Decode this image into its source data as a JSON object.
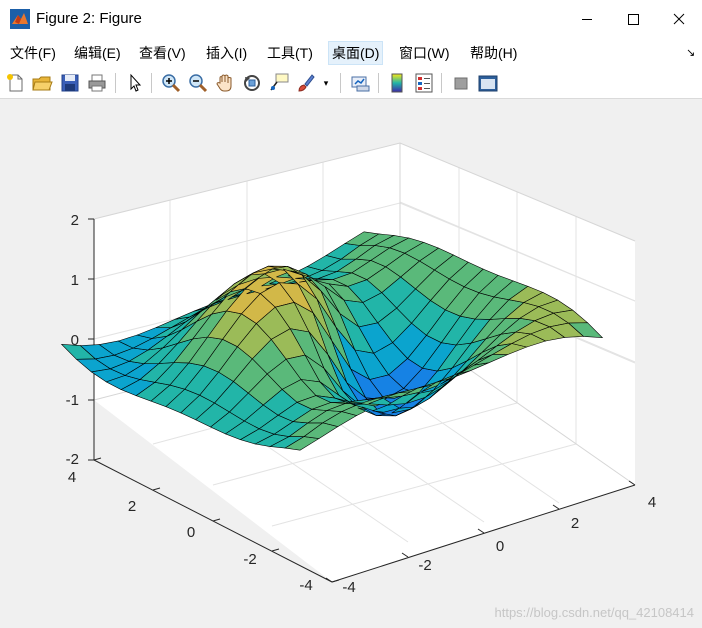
{
  "window": {
    "title": "Figure 2: Figure",
    "minimize_icon": "minimize-icon",
    "maximize_icon": "maximize-icon",
    "close_icon": "close-icon"
  },
  "menu": {
    "items": [
      {
        "label": "文件(F)"
      },
      {
        "label": "编辑(E)"
      },
      {
        "label": "查看(V)"
      },
      {
        "label": "插入(I)"
      },
      {
        "label": "工具(T)"
      },
      {
        "label": "桌面(D)"
      },
      {
        "label": "窗口(W)"
      },
      {
        "label": "帮助(H)"
      }
    ],
    "active_index": 5,
    "corner_icon": "dock-arrow-icon"
  },
  "toolbar": {
    "buttons": [
      "new-figure-icon",
      "open-file-icon",
      "save-icon",
      "print-icon",
      "pointer-icon",
      "zoom-in-icon",
      "zoom-out-icon",
      "pan-hand-icon",
      "rotate-3d-icon",
      "data-cursor-icon",
      "brush-icon",
      "link-plot-icon",
      "colorbar-icon",
      "legend-icon",
      "hide-plot-tools-icon",
      "show-plot-tools-icon"
    ]
  },
  "axes": {
    "z_ticks": [
      "2",
      "1",
      "0",
      "-1",
      "-2"
    ],
    "y_ticks": [
      "4",
      "2",
      "0",
      "-2",
      "-4"
    ],
    "x_ticks": [
      "-4",
      "-2",
      "0",
      "2",
      "4"
    ]
  },
  "colormap": [
    "#3e26a8",
    "#2e5cf6",
    "#1682e4",
    "#0ba4ce",
    "#22b5a8",
    "#5ab97a",
    "#9bbb58",
    "#d2b848",
    "#fcc03a",
    "#f9e916"
  ],
  "watermark": "https://blog.csdn.net/qq_42108414"
}
